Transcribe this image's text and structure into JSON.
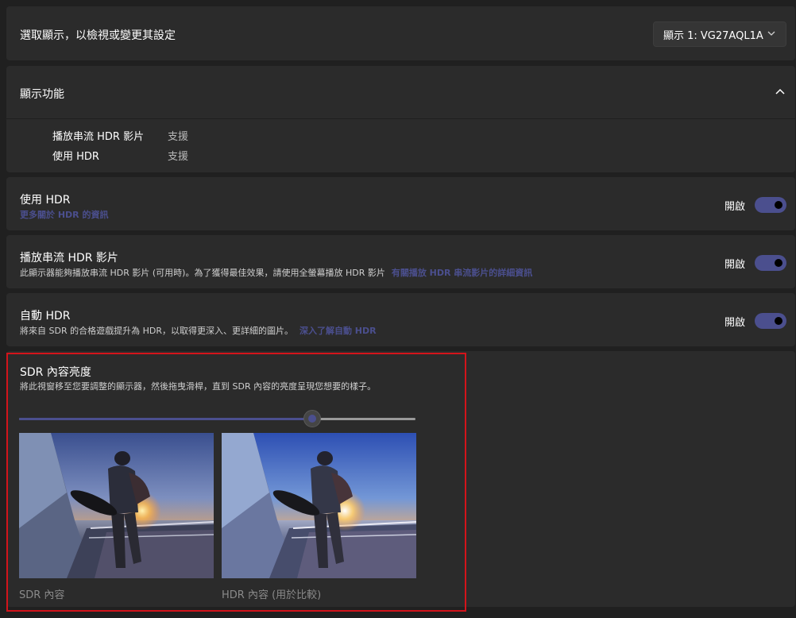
{
  "select_row": {
    "title": "選取顯示，以檢視或變更其設定",
    "dropdown_value": "顯示 1: VG27AQL1A"
  },
  "capabilities": {
    "title": "顯示功能",
    "items": [
      {
        "label": "播放串流 HDR 影片",
        "value": "支援"
      },
      {
        "label": "使用 HDR",
        "value": "支援"
      }
    ]
  },
  "use_hdr": {
    "title": "使用 HDR",
    "link": "更多關於 HDR 的資訊",
    "state": "開啟"
  },
  "stream_hdr": {
    "title": "播放串流 HDR 影片",
    "description": "此顯示器能夠播放串流 HDR 影片 (可用時)。為了獲得最佳效果，請使用全螢幕播放 HDR 影片",
    "link": "有關播放 HDR 串流影片的詳細資訊",
    "state": "開啟"
  },
  "auto_hdr": {
    "title": "自動 HDR",
    "description": "將來自 SDR 的合格遊戲提升為 HDR，以取得更深入、更詳細的圖片。",
    "link": "深入了解自動 HDR",
    "state": "開啟"
  },
  "sdr_brightness": {
    "title": "SDR 內容亮度",
    "description": "將此視窗移至您要調整的顯示器，然後拖曳滑桿，直到 SDR 內容的亮度呈現您想要的樣子。",
    "slider_value": 0.74,
    "sdr_caption": "SDR 內容",
    "hdr_caption": "HDR 內容 (用於比較)"
  },
  "colors": {
    "accent": "#4b4f8e",
    "background": "#202020",
    "card": "#2b2b2b",
    "highlight": "#d3141b"
  }
}
